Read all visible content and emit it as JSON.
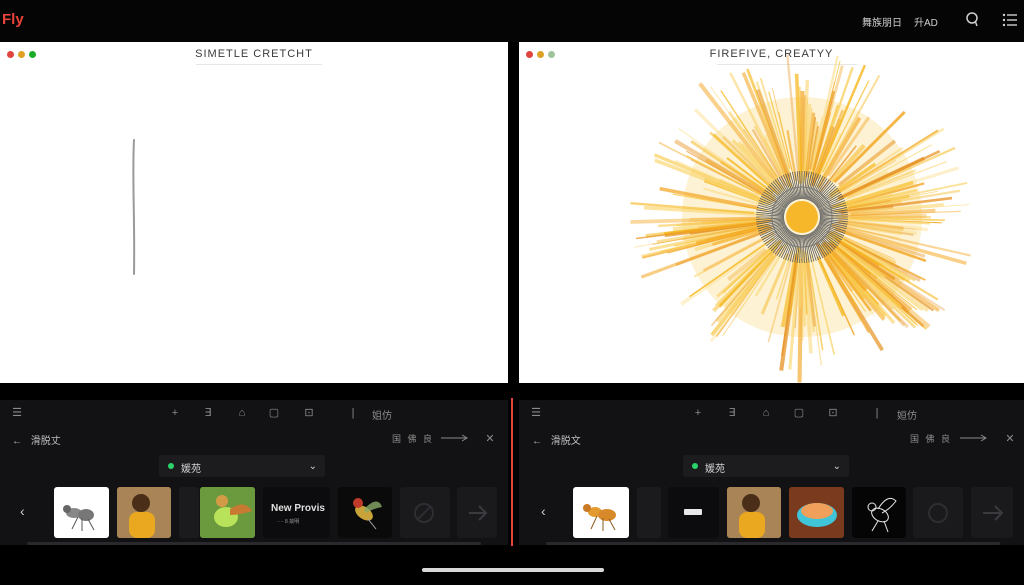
{
  "app": {
    "brand": "Fly"
  },
  "top_nav": {
    "link1": "舞族朋日",
    "link2": "升AD",
    "icons": [
      "search-icon",
      "menu-list-icon"
    ]
  },
  "left_canvas": {
    "title": "SIMETLE CRETCHT",
    "window_dots": [
      "#e0443e",
      "#dea123",
      "#1aab29"
    ]
  },
  "right_canvas": {
    "title": "FIREFIVE, CREATYY",
    "window_dots": [
      "#e0443e",
      "#dea123",
      "#9ec49c"
    ]
  },
  "left_panel": {
    "toolbar_label": "姐仿",
    "back_label": "滑脱丈",
    "right_label": "国 佛 良",
    "dropdown_value": "媛苑",
    "status_color": "#2bd46a",
    "new_project_label": "New Provis",
    "new_project_sub": "···· 8 故明"
  },
  "right_panel": {
    "toolbar_label": "姮仿",
    "back_label": "滑脱文",
    "right_label": "国 佛 良",
    "dropdown_value": "媛苑",
    "status_color": "#2bd46a"
  },
  "accent_color": "#e8433a"
}
